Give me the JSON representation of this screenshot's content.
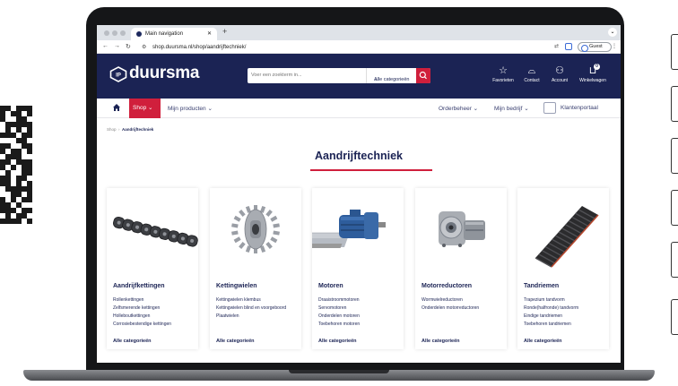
{
  "browser": {
    "tab_title": "Main navigation",
    "url": "shop.duursma.nl/shop/aandrijftechniek/",
    "profile_label": "Guest"
  },
  "header": {
    "logo_text": "duursma",
    "search_placeholder": "Voer een zoekterm in...",
    "search_category": "Alle categorieën",
    "favorites_label": "Favorieten",
    "contact_label": "Contact",
    "account_label": "Account",
    "cart_label": "Winkelwagen",
    "cart_count": "0"
  },
  "subnav": {
    "shop_label": "Shop",
    "my_products_label": "Mijn producten",
    "order_management_label": "Orderbeheer",
    "my_company_label": "Mijn bedrijf",
    "customer_portal_label": "Klantenportaal"
  },
  "breadcrumb": {
    "home": "Shop",
    "current": "Aandrijftechniek"
  },
  "page": {
    "title": "Aandrijftechniek"
  },
  "categories": [
    {
      "title": "Aandrijfkettingen",
      "links": [
        "Rollenkettingen",
        "Zelfsmerende kettingen",
        "Holleboutkettingen",
        "Corrosiebestendige kettingen"
      ],
      "all_label": "Alle categorieën"
    },
    {
      "title": "Kettingwielen",
      "links": [
        "Kettingwielen klembus",
        "Kettingwielen blind en voorgeboord",
        "Plaatwielen"
      ],
      "all_label": "Alle categorieën"
    },
    {
      "title": "Motoren",
      "links": [
        "Draaistroommotoren",
        "Servomotoren",
        "Onderdelen motoren",
        "Toebehoren motoren"
      ],
      "all_label": "Alle categorieën"
    },
    {
      "title": "Motorreductoren",
      "links": [
        "Wormwielreductoren",
        "Onderdelen motorreductoren"
      ],
      "all_label": "Alle categorieën"
    },
    {
      "title": "Tandriemen",
      "links": [
        "Trapezium tandvorm",
        "Ronde(halfronde) tandvorm",
        "Eindige tandriemen",
        "Toebehoren tandriemen"
      ],
      "all_label": "Alle categorieën"
    }
  ],
  "colors": {
    "brand_navy": "#1b2354",
    "brand_red": "#d01f3c"
  }
}
